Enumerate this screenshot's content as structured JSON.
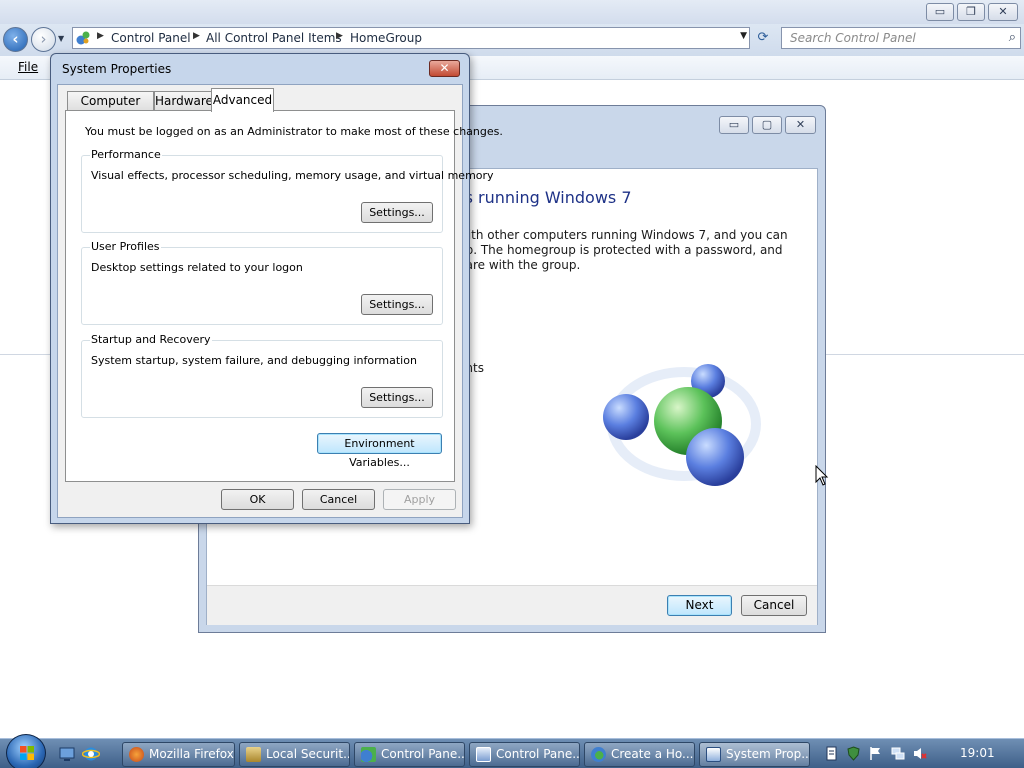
{
  "explorer": {
    "breadcrumb": [
      "Control Panel",
      "All Control Panel Items",
      "HomeGroup"
    ],
    "search_placeholder": "Search Control Panel",
    "menu": {
      "file": "File"
    },
    "caption_buttons": {
      "minimize": "▭",
      "restore": "❐",
      "close": "✕"
    }
  },
  "homegroup": {
    "heading": "rs running Windows 7",
    "body_lines": [
      "with other computers running Windows 7, and you can",
      "up. The homegroup is protected with a password, and",
      "hare with the group."
    ],
    "partial_text": "ents",
    "buttons": {
      "next": "Next",
      "cancel": "Cancel"
    }
  },
  "system_properties": {
    "title": "System Properties",
    "tabs": [
      "Computer Name",
      "Hardware",
      "Advanced"
    ],
    "active_tab": "Advanced",
    "admin_note": "You must be logged on as an Administrator to make most of these changes.",
    "groups": [
      {
        "label": "Performance",
        "description": "Visual effects, processor scheduling, memory usage, and virtual memory",
        "button": "Settings..."
      },
      {
        "label": "User Profiles",
        "description": "Desktop settings related to your logon",
        "button": "Settings..."
      },
      {
        "label": "Startup and Recovery",
        "description": "System startup, system failure, and debugging information",
        "button": "Settings..."
      }
    ],
    "env_button": "Environment Variables...",
    "buttons": {
      "ok": "OK",
      "cancel": "Cancel",
      "apply": "Apply"
    }
  },
  "taskbar": {
    "items": [
      {
        "label": "Mozilla Firefox",
        "icon": "firefox-icon"
      },
      {
        "label": "Local Securit...",
        "icon": "security-policy-icon"
      },
      {
        "label": "Control Pane...",
        "icon": "control-panel-icon"
      },
      {
        "label": "Control Pane...",
        "icon": "control-panel-icon"
      },
      {
        "label": "Create a Ho...",
        "icon": "homegroup-icon"
      },
      {
        "label": "System Prop...",
        "icon": "system-properties-icon"
      }
    ],
    "active_item": "System Prop...",
    "clock": "19:01"
  },
  "colors": {
    "heading_blue": "#1e3287",
    "taskbar_top": "#6f8fb4",
    "taskbar_bottom": "#3e5f88",
    "close_red": "#c24a32"
  }
}
